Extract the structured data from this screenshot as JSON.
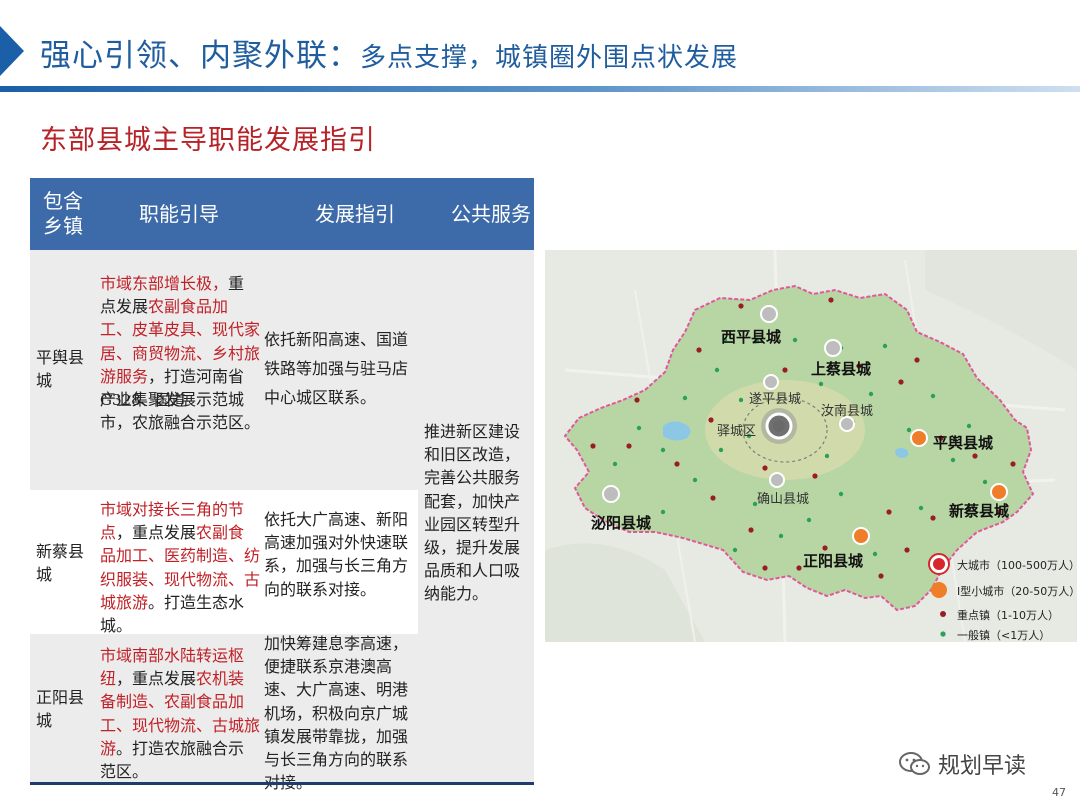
{
  "header": {
    "title_main": "强心引领、内聚外联：",
    "title_sub": "多点支撑，城镇圈外围点状发展"
  },
  "section_title": "东部县城主导职能发展指引",
  "table": {
    "headers": [
      "包含\n乡镇",
      "职能引导",
      "发展指引",
      "公共服务"
    ],
    "rows": [
      {
        "town": "平舆县城",
        "function_red1": "市域东部增长极，",
        "function_plain1": "重点发展",
        "function_red2": "农副食品加工、皮革皮具、现代家居、商贸物流、乡村旅游服务",
        "function_plain2": "，打造河南省产业集聚发展示范城市，农旅融合示范区。",
        "overlay_text": "G328、国道",
        "guide": "依托新阳高速、国道铁路等加强与驻马店中心城区联系。"
      },
      {
        "town": "新蔡县城",
        "function_red1": "市域对接长三角的节点",
        "function_plain1": "，重点发展",
        "function_red2": "农副食品加工、医药制造、纺织服装、现代物流、古城旅游",
        "function_plain2": "。打造生态水城。",
        "guide": "依托大广高速、新阳高速加强对外快速联系，加强与长三角方向的联系对接。"
      },
      {
        "town": "正阳县城",
        "function_red1": "市域南部水陆转运枢纽",
        "function_plain1": "，重点发展",
        "function_red2": "农机装备制造、农副食品加工、现代物流、古城旅游",
        "function_plain2": "。打造农旅融合示范区。",
        "guide": "加快筹建息李高速，便捷联系京港澳高速、大广高速、明港机场，积极向京广城镇发展带靠拢，加强与长三角方向的联系对接。"
      }
    ],
    "public_service": "推进新区建设和旧区改造，完善公共服务配套，加快产业园区转型升级，提升发展品质和人口吸纳能力。"
  },
  "map": {
    "labels": {
      "xiping": "西平县城",
      "shangcai": "上蔡县城",
      "suiping": "遂平县城",
      "runan": "汝南县城",
      "yicheng": "驿城区",
      "pingyu": "平舆县城",
      "queshan": "确山县城",
      "biyang": "泌阳县城",
      "xincai": "新蔡县城",
      "zhengyang": "正阳县城"
    },
    "legend": [
      {
        "label": "大城市（100-500万人）",
        "color": "#d8262d"
      },
      {
        "label": "I型小城市（20-50万人）",
        "color": "#ef7d2a"
      },
      {
        "label": "重点镇（1-10万人）",
        "color": "#9b1c24"
      },
      {
        "label": "一般镇（<1万人）",
        "color": "#2aa15a"
      }
    ],
    "colors": {
      "region_fill": "#b8d6a4",
      "boundary": "#e0579c",
      "big_city": "#d8262d",
      "small_city": "#ef7d2a",
      "key_town": "#9b1c24",
      "general_town": "#2aa15a",
      "county_seat": "#b9b9b9"
    }
  },
  "footer": {
    "logo_text": "规划早读",
    "page_number": "47"
  },
  "icons": [
    "header-arrow-icon",
    "wechat-icon"
  ]
}
